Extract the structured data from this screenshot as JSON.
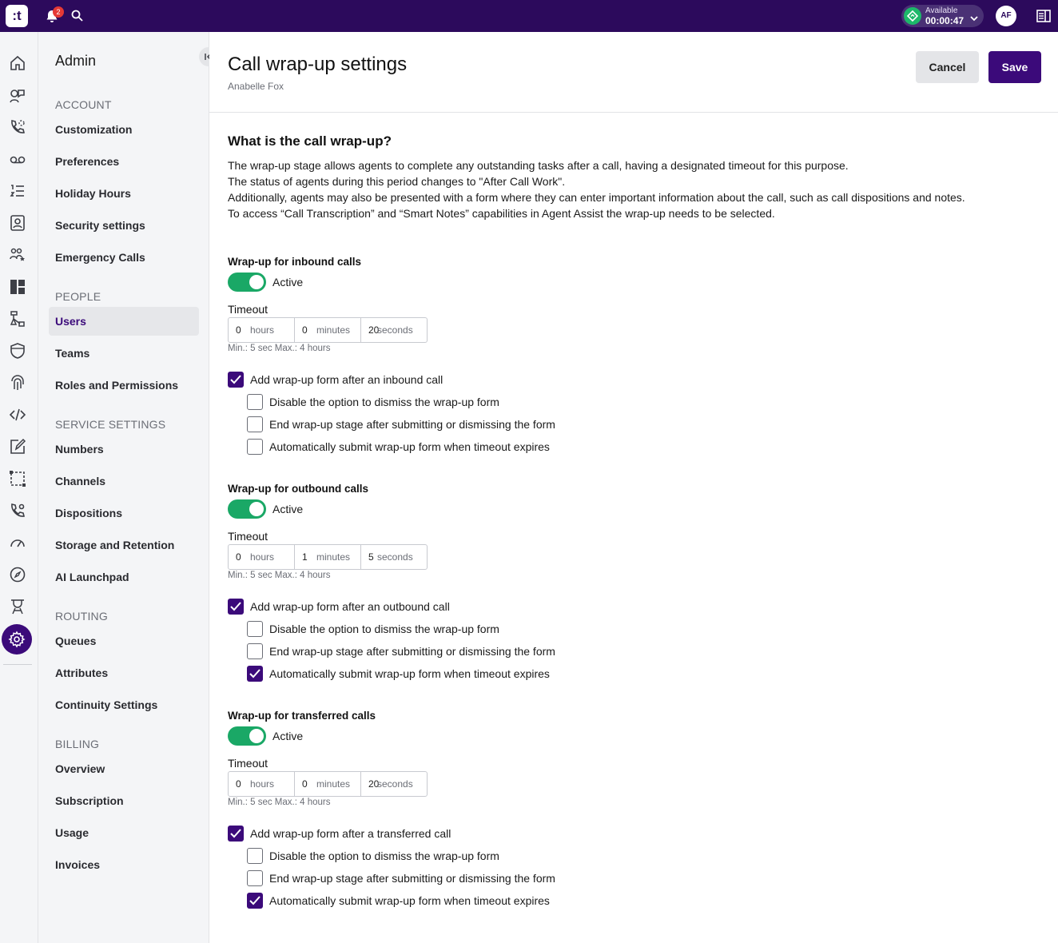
{
  "topbar": {
    "logo": ":t",
    "notification_count": "2",
    "status_label": "Available",
    "status_timer": "00:00:47",
    "avatar_initials": "AF"
  },
  "sidebar": {
    "title": "Admin",
    "sections": [
      {
        "label": "ACCOUNT",
        "items": [
          "Customization",
          "Preferences",
          "Holiday Hours",
          "Security settings",
          "Emergency Calls"
        ]
      },
      {
        "label": "PEOPLE",
        "items": [
          "Users",
          "Teams",
          "Roles and Permissions"
        ]
      },
      {
        "label": "SERVICE SETTINGS",
        "items": [
          "Numbers",
          "Channels",
          "Dispositions",
          "Storage and Retention",
          "AI Launchpad"
        ]
      },
      {
        "label": "ROUTING",
        "items": [
          "Queues",
          "Attributes",
          "Continuity Settings"
        ]
      },
      {
        "label": "BILLING",
        "items": [
          "Overview",
          "Subscription",
          "Usage",
          "Invoices"
        ]
      }
    ],
    "active_item": "Users"
  },
  "header": {
    "title": "Call wrap-up settings",
    "subtitle": "Anabelle Fox",
    "cancel_label": "Cancel",
    "save_label": "Save"
  },
  "intro": {
    "heading": "What is the call wrap-up?",
    "lines": [
      "The wrap-up stage allows agents to complete any outstanding tasks after a call, having a designated timeout for this purpose.",
      "The status of agents during this period changes to \"After Call Work\".",
      "Additionally, agents may also be presented with a form where they can enter important information about the call, such as call dispositions and notes.",
      "To access “Call Transcription” and “Smart Notes” capabilities in Agent Assist the wrap-up needs to be selected."
    ]
  },
  "common": {
    "active_label": "Active",
    "timeout_label": "Timeout",
    "hours_unit": "hours",
    "minutes_unit": "minutes",
    "seconds_unit": "seconds",
    "limits_hint": "Min.: 5 sec Max.: 4 hours",
    "opt_disable_dismiss": "Disable the option to dismiss the wrap-up form",
    "opt_end_stage": "End wrap-up stage after submitting or dismissing the form",
    "opt_auto_submit": "Automatically submit wrap-up form when timeout expires"
  },
  "sections": [
    {
      "title": "Wrap-up for inbound calls",
      "active": true,
      "hours": "0",
      "minutes": "0",
      "seconds": "20",
      "form_label": "Add wrap-up form after an inbound call",
      "form_checked": true,
      "disable_dismiss": false,
      "end_stage": false,
      "auto_submit": false
    },
    {
      "title": "Wrap-up for outbound calls",
      "active": true,
      "hours": "0",
      "minutes": "1",
      "seconds": "5",
      "form_label": "Add wrap-up form after an outbound call",
      "form_checked": true,
      "disable_dismiss": false,
      "end_stage": false,
      "auto_submit": true
    },
    {
      "title": "Wrap-up for transferred calls",
      "active": true,
      "hours": "0",
      "minutes": "0",
      "seconds": "20",
      "form_label": "Add wrap-up form after a transferred call",
      "form_checked": true,
      "disable_dismiss": false,
      "end_stage": false,
      "auto_submit": true
    }
  ],
  "colors": {
    "brand": "#2c0a5c",
    "accent": "#3b0a7a",
    "toggle_on": "#1aa866",
    "available": "#1db86a"
  }
}
